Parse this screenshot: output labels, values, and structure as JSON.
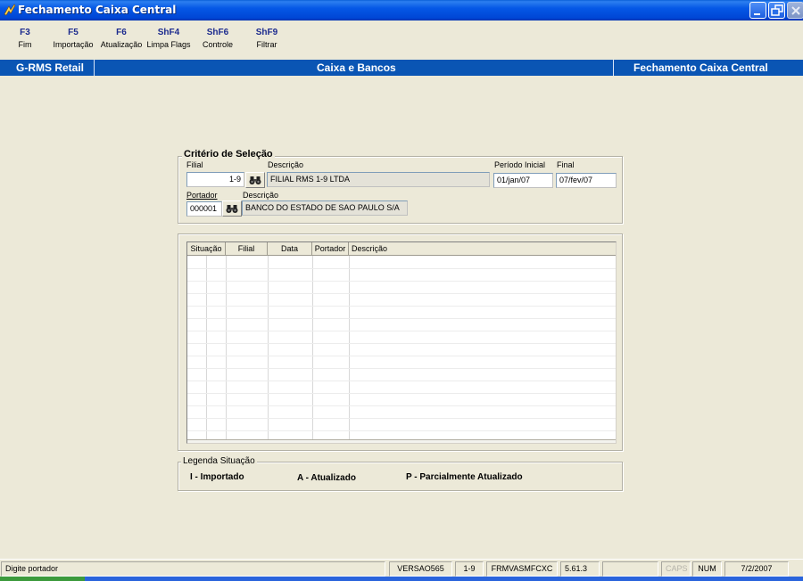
{
  "window": {
    "title": "Fechamento Caixa Central",
    "icon": "rms-app-icon",
    "controls": [
      "minimize-icon",
      "restore-icon",
      "close-icon"
    ]
  },
  "fkeys": [
    {
      "key": "F3",
      "label": "Fim"
    },
    {
      "key": "F5",
      "label": "Importação"
    },
    {
      "key": "F6",
      "label": "Atualização"
    },
    {
      "key": "ShF4",
      "label": "Limpa Flags"
    },
    {
      "key": "ShF6",
      "label": "Controle"
    },
    {
      "key": "ShF9",
      "label": "Filtrar"
    }
  ],
  "nav": {
    "left": "G-RMS Retail",
    "center": "Caixa e Bancos",
    "right": "Fechamento Caixa Central"
  },
  "criteria": {
    "caption": "Critério de Seleção",
    "filial_label": "Filial",
    "filial_value": "1-9",
    "filial_desc_label": "Descrição",
    "filial_desc_value": "FILIAL RMS 1-9 LTDA",
    "periodo_inicial_label": "Período Inicial",
    "periodo_inicial_value": "01/jan/07",
    "final_label": "Final",
    "final_value": "07/fev/07",
    "portador_label": "Portador",
    "portador_value": "000001",
    "portador_desc_label": "Descrição",
    "portador_desc_value": "BANCO DO ESTADO DE SAO PAULO S/A"
  },
  "grid": {
    "columns": [
      "Situação",
      "Filial",
      "Data",
      "Portador",
      "Descrição"
    ],
    "rows": []
  },
  "legend": {
    "caption": "Legenda Situação",
    "items": [
      "I - Importado",
      "A - Atualizado",
      "P - Parcialmente Atualizado"
    ]
  },
  "status": {
    "message": "Digite portador",
    "version": "VERSAO565",
    "filial": "1-9",
    "form": "FRMVASMFCXC",
    "build": "5.61.3",
    "blank": "",
    "caps": "CAPS",
    "num": "NUM",
    "date": "7/2/2007"
  },
  "colors": {
    "title_bar": "#0054e3",
    "nav_bar": "#0a55b4",
    "fkey_text": "#1c2b8e",
    "window_bg": "#ece9d8"
  }
}
